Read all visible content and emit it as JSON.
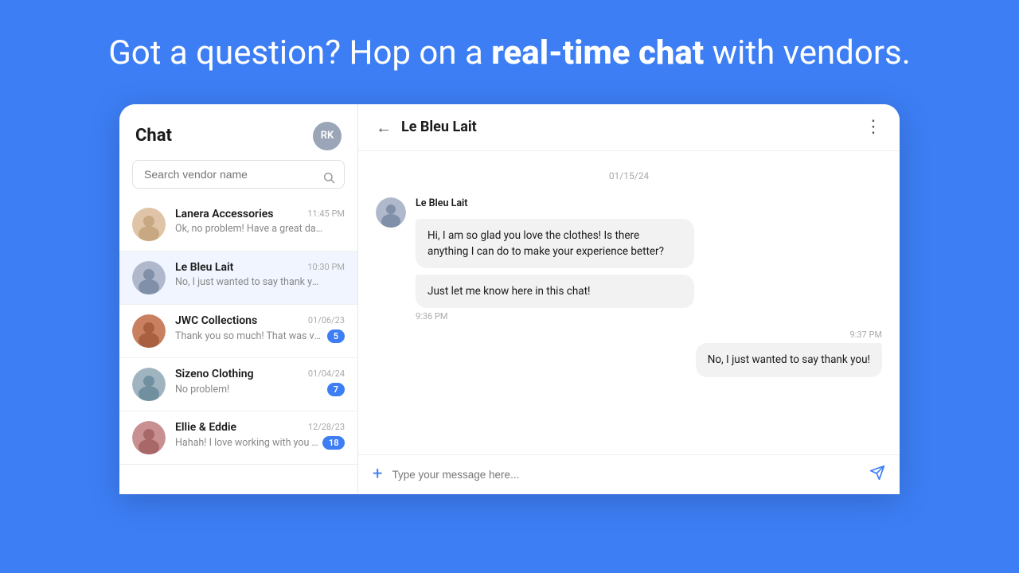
{
  "hero": {
    "text_plain": "Got a question? Hop on a ",
    "text_bold": "real-time chat",
    "text_end": " with vendors."
  },
  "sidebar": {
    "title": "Chat",
    "avatar_initials": "RK",
    "search_placeholder": "Search vendor name",
    "conversations": [
      {
        "id": "lanera",
        "name": "Lanera Accessories",
        "time": "11:45 PM",
        "preview": "Ok, no problem! Have a great day!",
        "badge": null,
        "active": false
      },
      {
        "id": "lebleu",
        "name": "Le Bleu Lait",
        "time": "10:30 PM",
        "preview": "No, I just wanted to say thank you!",
        "badge": null,
        "active": true
      },
      {
        "id": "jwc",
        "name": "JWC Collections",
        "time": "01/06/23",
        "preview": "Thank you so much! That was very helpful!",
        "badge": "5",
        "active": false
      },
      {
        "id": "sizeno",
        "name": "Sizeno Clothing",
        "time": "01/04/24",
        "preview": "No problem!",
        "badge": "7",
        "active": false
      },
      {
        "id": "ellie",
        "name": "Ellie & Eddie",
        "time": "12/28/23",
        "preview": "Hahah! I love working with you Sasha!",
        "badge": "18",
        "active": false
      }
    ]
  },
  "chat": {
    "vendor_name": "Le Bleu Lait",
    "date_divider": "01/15/24",
    "messages": [
      {
        "id": "m1",
        "sender": "vendor",
        "vendor_name": "Le Bleu Lait",
        "text": "Hi, I am so glad you love the clothes! Is there anything I can do to make your experience better?",
        "time": null
      },
      {
        "id": "m2",
        "sender": "vendor",
        "text": "Just let me know here in this chat!",
        "time": "9:36 PM"
      },
      {
        "id": "m3",
        "sender": "user",
        "text": "No, I just wanted to say thank you!",
        "time": "9:37 PM"
      }
    ],
    "input_placeholder": "Type your message here..."
  }
}
